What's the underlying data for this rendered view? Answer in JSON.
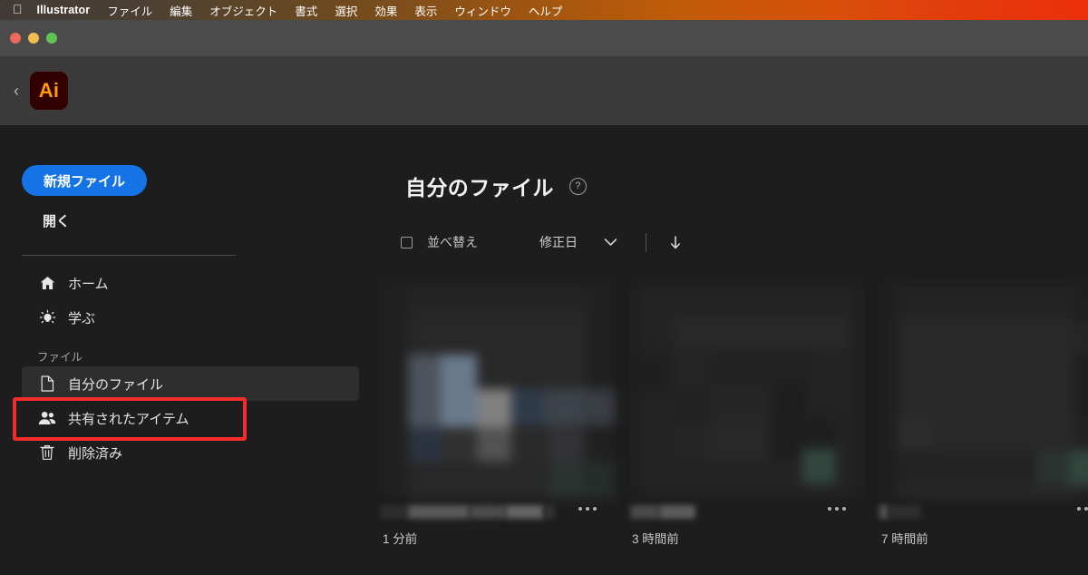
{
  "menubar": {
    "apple_icon": "apple-logo",
    "app_name": "Illustrator",
    "items": [
      "ファイル",
      "編集",
      "オブジェクト",
      "書式",
      "選択",
      "効果",
      "表示",
      "ウィンドウ",
      "ヘルプ"
    ],
    "gradient_start": "#413a36",
    "gradient_end": "#ec2f0c"
  },
  "window": {
    "close_label": "close-button",
    "minimize_label": "minimize-button",
    "maximize_label": "maximize-button",
    "titlebar_color": "#4b4b4b"
  },
  "appheader": {
    "back_chevron": "‹",
    "app_badge": "Ai",
    "badge_bg": "#330000",
    "badge_fg": "#ff9a00"
  },
  "sidebar": {
    "new_file_label": "新規ファイル",
    "new_file_color": "#1473e6",
    "open_label": "開く",
    "nav": [
      {
        "label": "ホーム",
        "icon": "home-icon",
        "active": false
      },
      {
        "label": "学ぶ",
        "icon": "lightbulb-icon",
        "active": false
      }
    ],
    "group_label": "ファイル",
    "files_nav": [
      {
        "label": "自分のファイル",
        "icon": "document-icon",
        "active": true
      },
      {
        "label": "共有されたアイテム",
        "icon": "people-icon",
        "active": false
      },
      {
        "label": "削除済み",
        "icon": "trash-icon",
        "active": false
      }
    ],
    "annotation_color": "#f52c2c"
  },
  "main": {
    "title": "自分のファイル",
    "help_icon": "?",
    "toolbar": {
      "select_all_checkbox": "select-all-checkbox",
      "sort_label": "並べ替え",
      "sort_value": "修正日",
      "chevron_icon": "chevron-down-icon",
      "direction_icon": "arrow-down-icon"
    },
    "files": [
      {
        "timestamp": "1 分前",
        "menu_icon": "more-options-icon"
      },
      {
        "timestamp": "3 時間前",
        "menu_icon": "more-options-icon"
      },
      {
        "timestamp": "7 時間前",
        "menu_icon": "more-options-icon"
      }
    ]
  }
}
